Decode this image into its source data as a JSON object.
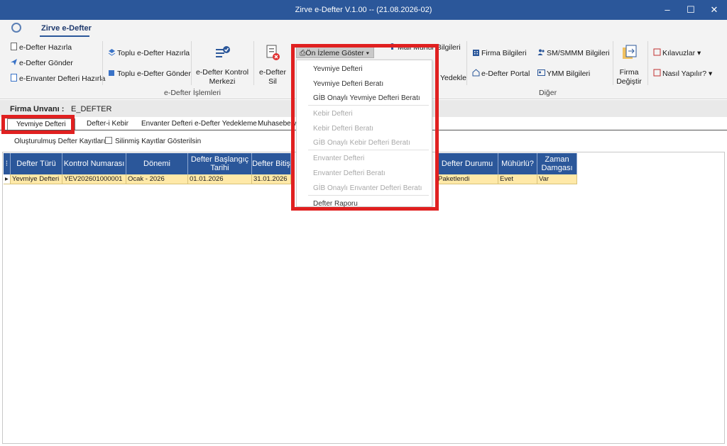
{
  "window": {
    "title": "Zirve e-Defter V.1.00  -- (21.08.2026-02)",
    "min": "–",
    "max": "☐",
    "close": "✕"
  },
  "ribbon_tab": "Zirve e-Defter",
  "ribbon": {
    "edefter_hazirla": "e-Defter Hazırla",
    "edefter_gonder": "e-Defter Gönder",
    "eenvanter_hazirla": "e-Envanter Defteri Hazırla",
    "toplu_hazirla": "Toplu e-Defter Hazırla",
    "toplu_gonder": "Toplu e-Defter Gönder",
    "kontrol_merkezi": "e-Defter Kontrol\nMerkezi",
    "kontrol_line1": "e-Defter Kontrol",
    "kontrol_line2": "Merkezi",
    "sil_line1": "e-Defter",
    "sil_line2": "Sil",
    "group_edefter": "e-Defter İşlemleri",
    "onizleme": "Ön İzleme Göster",
    "mali_muhur_partial": "Mali Mühür Bilgileri",
    "yedekle_partial": "Yedekle",
    "firma_bilgileri": "Firma Bilgileri",
    "edefter_portal": "e-Defter Portal",
    "smsmmm": "SM/SMMM Bilgileri",
    "ymm": "YMM Bilgileri",
    "firma_degistir_line1": "Firma",
    "firma_degistir_line2": "Değiştir",
    "kilavuzlar": "Kılavuzlar",
    "nasil_yapilir": "Nasıl Yapılır?",
    "group_diger": "Diğer"
  },
  "firma": {
    "label": "Firma Unvanı :",
    "value": "E_DEFTER"
  },
  "subtabs": [
    "Yevmiye Defteri",
    "Defter-i Kebir",
    "Envanter Defteri",
    "e-Defter Yedekleme",
    "Muhasebe v"
  ],
  "options": {
    "olusturulmus": "Oluşturulmuş Defter Kayıtları",
    "silinmis": "Silinmiş Kayıtlar Gösterilsin"
  },
  "grid": {
    "columns": [
      "Defter Türü",
      "Kontrol Numarası",
      "Dönemi",
      "Defter Başlangıç Tarihi",
      "Defter Bitiş",
      "Defter Durumu",
      "Mühürlü?",
      "Zaman Damgası"
    ],
    "row": [
      "Yevmiye Defteri",
      "YEV202601000001",
      "Ocak - 2026",
      "01.01.2026",
      "31.01.2026",
      "Paketlendi",
      "Evet",
      "Var"
    ]
  },
  "dropdown": {
    "items": [
      {
        "label": "Yevmiye Defteri",
        "enabled": true
      },
      {
        "label": "Yevmiye Defteri Beratı",
        "enabled": true
      },
      {
        "label": "GİB Onaylı Yevmiye Defteri Beratı",
        "enabled": true
      },
      {
        "label": "Kebir Defteri",
        "enabled": false
      },
      {
        "label": "Kebir Defteri Beratı",
        "enabled": false
      },
      {
        "label": "GİB Onaylı Kebir Defteri Beratı",
        "enabled": false
      },
      {
        "label": "Envanter Defteri",
        "enabled": false
      },
      {
        "label": "Envanter Defteri Beratı",
        "enabled": false
      },
      {
        "label": "GİB Onaylı Envanter Defteri Beratı",
        "enabled": false
      },
      {
        "label": "Defter Raporu",
        "enabled": true
      }
    ]
  },
  "colors": {
    "accent": "#2b579a",
    "highlight": "#e02020",
    "row": "#ffe9a8"
  }
}
